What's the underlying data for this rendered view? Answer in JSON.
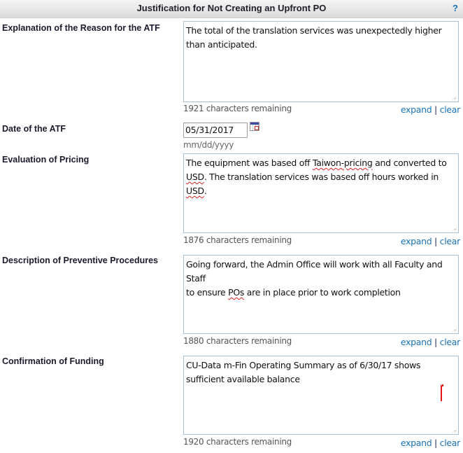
{
  "header": {
    "title": "Justification for Not Creating an Upfront PO",
    "help_label": "?"
  },
  "fields": [
    {
      "label": "Explanation of the Reason for the ATF",
      "value": "The total of the translation services was unexpectedly higher than anticipated.",
      "counter": "1921 characters remaining"
    },
    {
      "label": "Date of the ATF",
      "value": "05/31/2017",
      "hint": "mm/dd/yyyy"
    },
    {
      "label": "Evaluation of Pricing",
      "value": "The equipment was based off Taiwon-pricing and converted to USD. The translation services was based off hours worked in USD.",
      "counter": "1876 characters remaining"
    },
    {
      "label": "Description of Preventive Procedures",
      "value": "Going forward, the Admin Office will work with all Faculty and Staff to ensure POs are in place prior to work completion",
      "counter": "1880 characters remaining"
    },
    {
      "label": "Confirmation of Funding",
      "value": "CU-Data m-Fin Operating Summary as of 6/30/17 shows sufficient available balance",
      "counter": "1920 characters remaining"
    }
  ],
  "text_parts": {
    "pricing_l1a": "The equipment was based off ",
    "pricing_l1b": "Taiwon-pricing",
    "pricing_l1c": " and converted to",
    "pricing_l2a": "USD",
    "pricing_l2b": ". The translation services was based off hours worked in ",
    "pricing_l2c": "USD",
    "pricing_l2d": ".",
    "prev_l1": "Going forward, the Admin Office will work with all Faculty and Staff",
    "prev_l2a": "to ensure ",
    "prev_l2b": "POs",
    "prev_l2c": " are in place prior to work completion"
  },
  "actions": {
    "expand_label": "expand",
    "separator": "|",
    "clear_label": "clear"
  },
  "icons": {
    "help": "question-mark",
    "calendar": "calendar-icon",
    "resize": "resize-grip"
  },
  "colors": {
    "link": "#1a73b8",
    "textarea_border": "#a9bfd6",
    "spellcheck": "#e02020"
  }
}
